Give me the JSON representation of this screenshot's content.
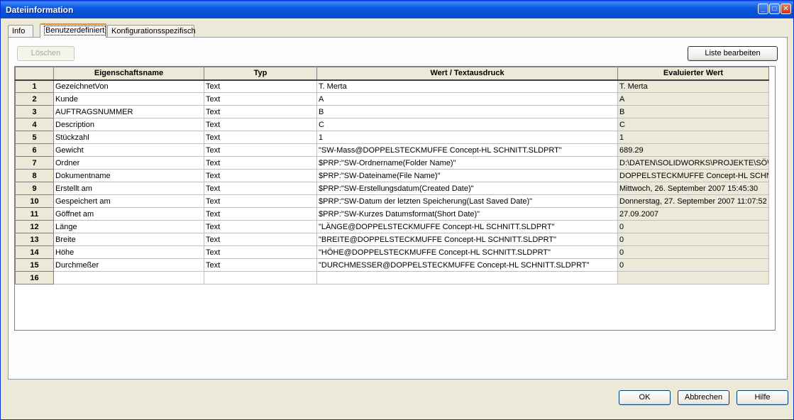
{
  "window": {
    "title": "Dateiinformation"
  },
  "tabs": [
    "Info",
    "Benutzerdefiniert",
    "Konfigurationsspezifisch"
  ],
  "toolbar": {
    "delete_label": "Löschen",
    "edit_list_label": "Liste bearbeiten"
  },
  "columns": [
    "Eigenschaftsname",
    "Typ",
    "Wert / Textausdruck",
    "Evaluierter Wert"
  ],
  "rows": [
    {
      "num": "1",
      "name": "GezeichnetVon",
      "type": "Text",
      "value": "T. Merta",
      "evaluated": "T. Merta"
    },
    {
      "num": "2",
      "name": "Kunde",
      "type": "Text",
      "value": "A",
      "evaluated": "A"
    },
    {
      "num": "3",
      "name": "AUFTRAGSNUMMER",
      "type": "Text",
      "value": "B",
      "evaluated": "B"
    },
    {
      "num": "4",
      "name": "Description",
      "type": "Text",
      "value": "C",
      "evaluated": "C"
    },
    {
      "num": "5",
      "name": "Stückzahl",
      "type": "Text",
      "value": "1",
      "evaluated": "1"
    },
    {
      "num": "6",
      "name": "Gewicht",
      "type": "Text",
      "value": "\"SW-Mass@DOPPELSTECKMUFFE Concept-HL SCHNITT.SLDPRT\"",
      "evaluated": "689.29"
    },
    {
      "num": "7",
      "name": "Ordner",
      "type": "Text",
      "value": "$PRP:\"SW-Ordnername(Folder Name)\"",
      "evaluated": "D:\\DATEN\\SOLIDWORKS\\PROJEKTE\\SÖ\\KU"
    },
    {
      "num": "8",
      "name": "Dokumentname",
      "type": "Text",
      "value": "$PRP:\"SW-Dateiname(File Name)\"",
      "evaluated": "DOPPELSTECKMUFFE Concept-HL SCHNITT"
    },
    {
      "num": "9",
      "name": "Erstellt am",
      "type": "Text",
      "value": "$PRP:\"SW-Erstellungsdatum(Created Date)\"",
      "evaluated": "Mittwoch, 26. September 2007 15:45:30"
    },
    {
      "num": "10",
      "name": "Gespeichert am",
      "type": "Text",
      "value": "$PRP:\"SW-Datum der letzten Speicherung(Last Saved Date)\"",
      "evaluated": "Donnerstag, 27. September 2007 11:07:52"
    },
    {
      "num": "11",
      "name": "Göffnet am",
      "type": "Text",
      "value": "$PRP:\"SW-Kurzes Datumsformat(Short Date)\"",
      "evaluated": "27.09.2007"
    },
    {
      "num": "12",
      "name": "Länge",
      "type": "Text",
      "value": "\"LÄNGE@DOPPELSTECKMUFFE Concept-HL SCHNITT.SLDPRT\"",
      "evaluated": "0"
    },
    {
      "num": "13",
      "name": "Breite",
      "type": "Text",
      "value": "\"BREITE@DOPPELSTECKMUFFE Concept-HL SCHNITT.SLDPRT\"",
      "evaluated": "0"
    },
    {
      "num": "14",
      "name": "Höhe",
      "type": "Text",
      "value": "\"HÖHE@DOPPELSTECKMUFFE Concept-HL SCHNITT.SLDPRT\"",
      "evaluated": "0"
    },
    {
      "num": "15",
      "name": "Durchmeßer",
      "type": "Text",
      "value": "\"DURCHMESSER@DOPPELSTECKMUFFE Concept-HL SCHNITT.SLDPRT\"",
      "evaluated": "0"
    },
    {
      "num": "16",
      "name": "",
      "type": "",
      "value": "",
      "evaluated": ""
    }
  ],
  "footer": {
    "ok_label": "OK",
    "cancel_label": "Abbrechen",
    "help_label": "Hilfe"
  },
  "colors": {
    "titlebar": "#0a5ae0",
    "active_tab_accent": "#e68b2c",
    "dialog_bg": "#ece9d8"
  }
}
